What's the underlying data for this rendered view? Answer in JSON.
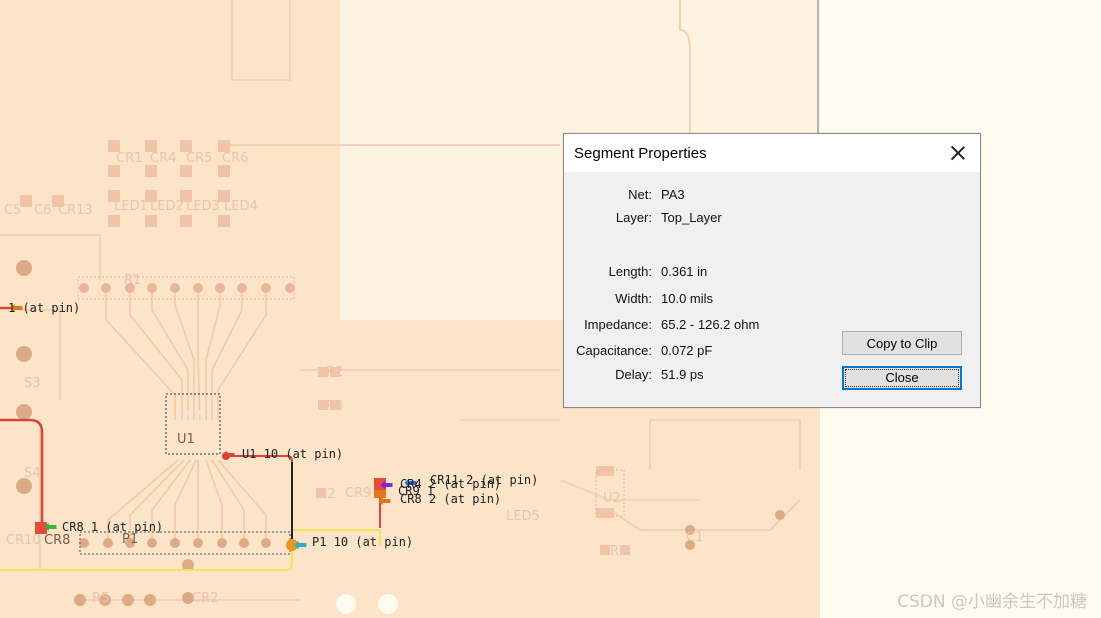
{
  "dialog": {
    "title": "Segment Properties",
    "fields": [
      {
        "label": "Net:",
        "value": "PA3"
      },
      {
        "label": "Layer:",
        "value": "Top_Layer"
      },
      {
        "label": "Length:",
        "value": "0.361 in"
      },
      {
        "label": "Width:",
        "value": "10.0 mils"
      },
      {
        "label": "Impedance:",
        "value": "65.2 - 126.2 ohm"
      },
      {
        "label": "Capacitance:",
        "value": "0.072 pF"
      },
      {
        "label": "Delay:",
        "value": "51.9 ps"
      }
    ],
    "copy_button": "Copy to Clip",
    "close_button": "Close"
  },
  "pcb": {
    "component_labels": [
      "CR1",
      "CR4",
      "CR5",
      "CR6",
      "LED1",
      "LED2",
      "LED3",
      "LED4",
      "C5",
      "C6",
      "CR13",
      "S3",
      "S4",
      "CR8",
      "CR10",
      "P1",
      "U1",
      "U2",
      "CR2",
      "LED5",
      "R1",
      "C1",
      "R2",
      "R3",
      "C2",
      "R5",
      "R6",
      "CR9"
    ],
    "pin_annotations": [
      "1 (at pin)",
      "U1 10 (at pin)",
      "CR8 1 (at pin)",
      "P1 10 (at pin)",
      "CR11 2 (at pin)",
      "CR4 2 (at pin)",
      "CR8 2 (at pin)",
      "CR9 1"
    ]
  },
  "watermark": "CSDN @小幽余生不加糖",
  "colors": {
    "board": "#fdf3e1",
    "trace": "#f6cba8",
    "selected_trace": "#d9433a",
    "yellow_trace": "#f2e35c",
    "dialog_bg": "#f0f0f0",
    "accent": "#0078d7"
  }
}
